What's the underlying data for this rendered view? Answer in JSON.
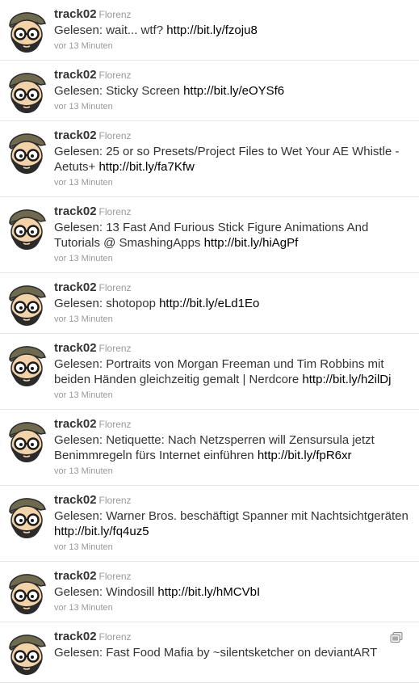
{
  "tweets": [
    {
      "user": "track02",
      "fullname": "Florenz",
      "text": "Gelesen: wait... wtf? ",
      "link": "http://bit.ly/fzoju8",
      "time": "vor 13 Minuten"
    },
    {
      "user": "track02",
      "fullname": "Florenz",
      "text": "Gelesen: Sticky Screen ",
      "link": "http://bit.ly/eOYSf6",
      "time": "vor 13 Minuten"
    },
    {
      "user": "track02",
      "fullname": "Florenz",
      "text": "Gelesen: 25 or so Presets/Project Files to Wet Your AE Whistle - Aetuts+ ",
      "link": "http://bit.ly/fa7Kfw",
      "time": "vor 13 Minuten"
    },
    {
      "user": "track02",
      "fullname": "Florenz",
      "text": "Gelesen: 13 Fast And Furious Stick Figure Animations And Tutorials @ SmashingApps ",
      "link": "http://bit.ly/hiAgPf",
      "time": "vor 13 Minuten"
    },
    {
      "user": "track02",
      "fullname": "Florenz",
      "text": "Gelesen: shotopop ",
      "link": "http://bit.ly/eLd1Eo",
      "time": "vor 13 Minuten"
    },
    {
      "user": "track02",
      "fullname": "Florenz",
      "text": "Gelesen: Portraits von Morgan Freeman und Tim Robbins mit beiden Händen gleichzeitig gemalt | Nerdcore ",
      "link": "http://bit.ly/h2ilDj",
      "time": "vor 13 Minuten"
    },
    {
      "user": "track02",
      "fullname": "Florenz",
      "text": "Gelesen: Netiquette: Nach Netzsperren will Zensursula jetzt Benimmregeln fürs Internet einführen ",
      "link": "http://bit.ly/fpR6xr",
      "time": "vor 13 Minuten"
    },
    {
      "user": "track02",
      "fullname": "Florenz",
      "text": "Gelesen: Warner Bros. beschäftigt Spanner mit Nachtsichtgeräten ",
      "link": "http://bit.ly/fq4uz5",
      "time": "vor 13 Minuten"
    },
    {
      "user": "track02",
      "fullname": "Florenz",
      "text": "Gelesen: Windosill ",
      "link": "http://bit.ly/hMCVbI",
      "time": "vor 13 Minuten"
    },
    {
      "user": "track02",
      "fullname": "Florenz",
      "text": "Gelesen: Fast Food Mafia by ~silentsketcher on deviantART",
      "link": "",
      "time": "",
      "has_expand_icon": true
    }
  ]
}
